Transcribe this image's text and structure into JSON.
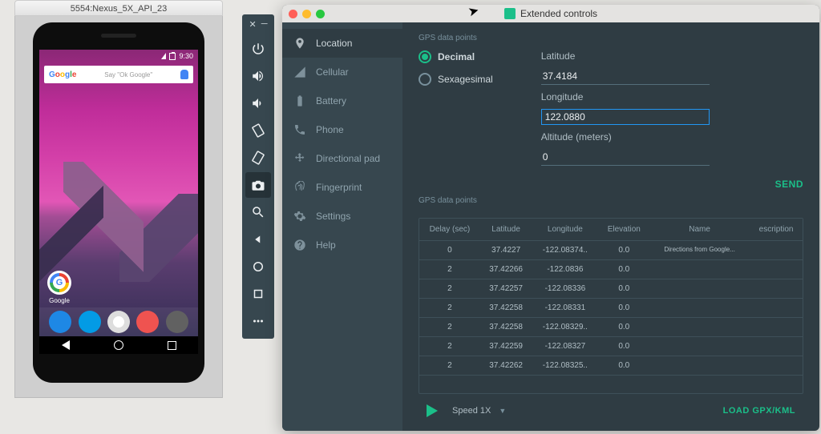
{
  "emulator": {
    "window_title": "5554:Nexus_5X_API_23",
    "status_time": "9:30",
    "say_hint": "Say \"Ok Google\"",
    "app_label": "Google"
  },
  "toolstrip": {
    "items": [
      "close",
      "minimize",
      "power",
      "volume-up",
      "volume-down",
      "rotate-left",
      "rotate-right",
      "camera",
      "zoom",
      "back",
      "home",
      "recents",
      "more"
    ]
  },
  "ext": {
    "title": "Extended controls",
    "sidebar": [
      {
        "id": "location",
        "label": "Location",
        "icon": "location"
      },
      {
        "id": "cellular",
        "label": "Cellular",
        "icon": "signal"
      },
      {
        "id": "battery",
        "label": "Battery",
        "icon": "battery"
      },
      {
        "id": "phone",
        "label": "Phone",
        "icon": "phone"
      },
      {
        "id": "dpad",
        "label": "Directional pad",
        "icon": "dpad"
      },
      {
        "id": "fingerprint",
        "label": "Fingerprint",
        "icon": "fingerprint"
      },
      {
        "id": "settings",
        "label": "Settings",
        "icon": "settings"
      },
      {
        "id": "help",
        "label": "Help",
        "icon": "help"
      }
    ],
    "gps_heading": "GPS data points",
    "radios": {
      "decimal": "Decimal",
      "sexagesimal": "Sexagesimal"
    },
    "fields": {
      "latitude_label": "Latitude",
      "latitude_value": "37.4184",
      "longitude_label": "Longitude",
      "longitude_value": "122.0880",
      "altitude_label": "Altitude (meters)",
      "altitude_value": "0"
    },
    "send_label": "SEND",
    "table": {
      "headers": [
        "Delay (sec)",
        "Latitude",
        "Longitude",
        "Elevation",
        "Name",
        "escription"
      ],
      "rows": [
        {
          "delay": "0",
          "lat": "37.4227",
          "lon": "-122.08374..",
          "elev": "0.0",
          "name": "Directions from Google...",
          "desc": ""
        },
        {
          "delay": "2",
          "lat": "37.42266",
          "lon": "-122.0836",
          "elev": "0.0",
          "name": "",
          "desc": ""
        },
        {
          "delay": "2",
          "lat": "37.42257",
          "lon": "-122.08336",
          "elev": "0.0",
          "name": "",
          "desc": ""
        },
        {
          "delay": "2",
          "lat": "37.42258",
          "lon": "-122.08331",
          "elev": "0.0",
          "name": "",
          "desc": ""
        },
        {
          "delay": "2",
          "lat": "37.42258",
          "lon": "-122.08329..",
          "elev": "0.0",
          "name": "",
          "desc": ""
        },
        {
          "delay": "2",
          "lat": "37.42259",
          "lon": "-122.08327",
          "elev": "0.0",
          "name": "",
          "desc": ""
        },
        {
          "delay": "2",
          "lat": "37.42262",
          "lon": "-122.08325..",
          "elev": "0.0",
          "name": "",
          "desc": ""
        }
      ]
    },
    "playback": {
      "speed": "Speed 1X",
      "load": "LOAD GPX/KML"
    }
  }
}
